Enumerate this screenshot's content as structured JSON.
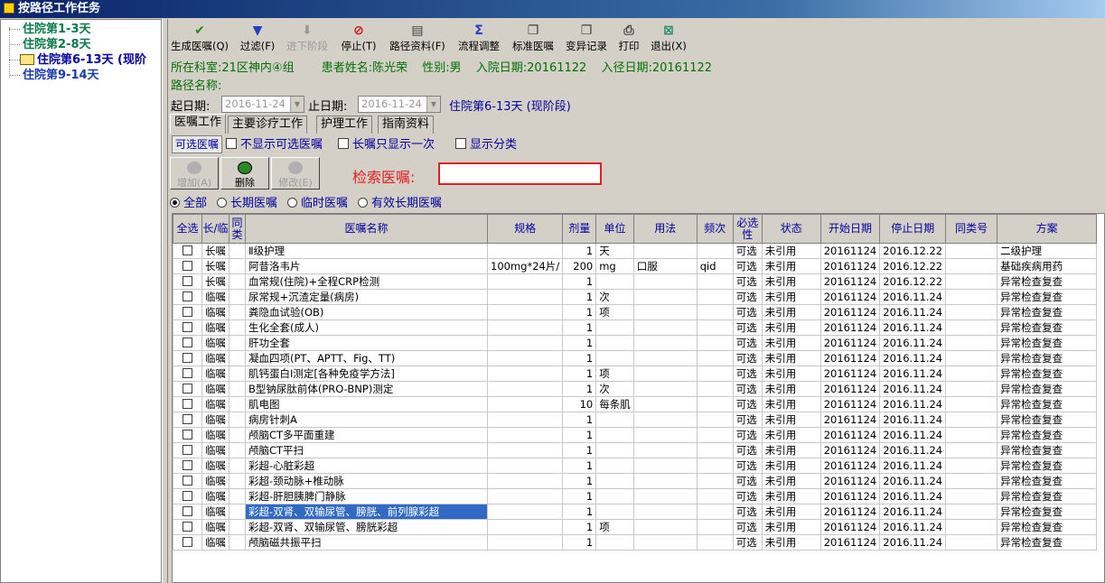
{
  "window": {
    "title": "按路径工作任务"
  },
  "tree": {
    "items": [
      {
        "label": "住院第1-3天"
      },
      {
        "label": "住院第2-8天"
      },
      {
        "label": "住院第6-13天 (现阶"
      },
      {
        "label": "住院第9-14天"
      }
    ]
  },
  "toolbar": {
    "items": [
      {
        "label": "生成医嘱(Q)",
        "icon": "check-icon"
      },
      {
        "label": "过滤(F)",
        "icon": "filter-icon"
      },
      {
        "label": "进下阶段",
        "icon": "arrow-down-icon"
      },
      {
        "label": "停止(T)",
        "icon": "stop-icon"
      },
      {
        "label": "路径资料(F)",
        "icon": "document-icon"
      },
      {
        "label": "流程调整",
        "icon": "sigma-icon"
      },
      {
        "label": "标准医嘱",
        "icon": "copy-icon"
      },
      {
        "label": "变异记录",
        "icon": "copy-icon"
      },
      {
        "label": "打印",
        "icon": "printer-icon"
      },
      {
        "label": "退出(X)",
        "icon": "exit-icon"
      }
    ]
  },
  "patient": {
    "dept": "所在科室:21区神内④组",
    "name": "患者姓名:陈光荣",
    "sex": "性别:男",
    "admit": "入院日期:20161122",
    "enter_path": "入径日期:20161122",
    "path_name": "路径名称:"
  },
  "dates": {
    "start_label": "起日期:",
    "start_value": "2016-11-24",
    "end_label": "止日期:",
    "end_value": "2016-11-24",
    "stage": "住院第6-13天 (现阶段)"
  },
  "tabs": [
    "医嘱工作",
    "主要诊疗工作",
    "护理工作",
    "指南资料"
  ],
  "options": {
    "optional_btn": "可选医嘱",
    "hide_optional": "不显示可选医嘱",
    "long_only_once": "长嘱只显示一次",
    "show_category": "显示分类"
  },
  "buttons": {
    "add": "增加(A)",
    "delete": "删除",
    "modify": "修改(E)"
  },
  "search": {
    "label": "检索医嘱:",
    "value": ""
  },
  "filters": {
    "all": "全部",
    "long": "长期医嘱",
    "temp": "临时医嘱",
    "valid_long": "有效长期医嘱"
  },
  "table": {
    "headers": [
      "全选",
      "长/临",
      "同类",
      "医嘱名称",
      "规格",
      "剂量",
      "单位",
      "用法",
      "频次",
      "必选性",
      "状态",
      "开始日期",
      "停止日期",
      "同类号",
      "方案"
    ],
    "rows": [
      [
        "长嘱",
        "Ⅱ级护理",
        "",
        "1",
        "天",
        "",
        "",
        "可选",
        "未引用",
        "20161124",
        "2016.12.22",
        "",
        "二级护理"
      ],
      [
        "长嘱",
        "阿昔洛韦片",
        "100mg*24片/",
        "200",
        "mg",
        "口服",
        "qid",
        "可选",
        "未引用",
        "20161124",
        "2016.12.22",
        "",
        "基础疾病用药"
      ],
      [
        "长嘱",
        "血常规(住院)+全程CRP检测",
        "",
        "1",
        "",
        "",
        "",
        "可选",
        "未引用",
        "20161124",
        "2016.12.22",
        "",
        "异常检查复查"
      ],
      [
        "临嘱",
        "尿常规+沉渣定量(病房)",
        "",
        "1",
        "次",
        "",
        "",
        "可选",
        "未引用",
        "20161124",
        "2016.11.24",
        "",
        "异常检查复查"
      ],
      [
        "临嘱",
        "粪隐血试验(OB)",
        "",
        "1",
        "项",
        "",
        "",
        "可选",
        "未引用",
        "20161124",
        "2016.11.24",
        "",
        "异常检查复查"
      ],
      [
        "临嘱",
        "生化全套(成人)",
        "",
        "1",
        "",
        "",
        "",
        "可选",
        "未引用",
        "20161124",
        "2016.11.24",
        "",
        "异常检查复查"
      ],
      [
        "临嘱",
        "肝功全套",
        "",
        "1",
        "",
        "",
        "",
        "可选",
        "未引用",
        "20161124",
        "2016.11.24",
        "",
        "异常检查复查"
      ],
      [
        "临嘱",
        "凝血四项(PT、APTT、Fig、TT)",
        "",
        "1",
        "",
        "",
        "",
        "可选",
        "未引用",
        "20161124",
        "2016.11.24",
        "",
        "异常检查复查"
      ],
      [
        "临嘱",
        "肌钙蛋白Ⅰ测定[各种免疫学方法]",
        "",
        "1",
        "项",
        "",
        "",
        "可选",
        "未引用",
        "20161124",
        "2016.11.24",
        "",
        "异常检查复查"
      ],
      [
        "临嘱",
        "B型钠尿肽前体(PRO-BNP)测定",
        "",
        "1",
        "次",
        "",
        "",
        "可选",
        "未引用",
        "20161124",
        "2016.11.24",
        "",
        "异常检查复查"
      ],
      [
        "临嘱",
        "肌电图",
        "",
        "10",
        "每条肌",
        "",
        "",
        "可选",
        "未引用",
        "20161124",
        "2016.11.24",
        "",
        "异常检查复查"
      ],
      [
        "临嘱",
        "病房针刺A",
        "",
        "1",
        "",
        "",
        "",
        "可选",
        "未引用",
        "20161124",
        "2016.11.24",
        "",
        "异常检查复查"
      ],
      [
        "临嘱",
        "颅脑CT多平面重建",
        "",
        "1",
        "",
        "",
        "",
        "可选",
        "未引用",
        "20161124",
        "2016.11.24",
        "",
        "异常检查复查"
      ],
      [
        "临嘱",
        "颅脑CT平扫",
        "",
        "1",
        "",
        "",
        "",
        "可选",
        "未引用",
        "20161124",
        "2016.11.24",
        "",
        "异常检查复查"
      ],
      [
        "临嘱",
        "彩超-心脏彩超",
        "",
        "1",
        "",
        "",
        "",
        "可选",
        "未引用",
        "20161124",
        "2016.11.24",
        "",
        "异常检查复查"
      ],
      [
        "临嘱",
        "彩超-颈动脉+椎动脉",
        "",
        "1",
        "",
        "",
        "",
        "可选",
        "未引用",
        "20161124",
        "2016.11.24",
        "",
        "异常检查复查"
      ],
      [
        "临嘱",
        "彩超-肝胆胰脾门静脉",
        "",
        "1",
        "",
        "",
        "",
        "可选",
        "未引用",
        "20161124",
        "2016.11.24",
        "",
        "异常检查复查"
      ],
      [
        "临嘱",
        "彩超-双肾、双输尿管、膀胱、前列腺彩超",
        "",
        "1",
        "",
        "",
        "",
        "可选",
        "未引用",
        "20161124",
        "2016.11.24",
        "",
        "异常检查复查"
      ],
      [
        "临嘱",
        "彩超-双肾、双输尿管、膀胱彩超",
        "",
        "1",
        "项",
        "",
        "",
        "可选",
        "未引用",
        "20161124",
        "2016.11.24",
        "",
        "异常检查复查"
      ],
      [
        "临嘱",
        "颅脑磁共振平扫",
        "",
        "1",
        "",
        "",
        "",
        "可选",
        "未引用",
        "20161124",
        "2016.11.24",
        "",
        "异常检查复查"
      ]
    ],
    "selected_row": 17
  },
  "colors": {
    "title_bar": "#0a246a",
    "info_green": "#007000",
    "label_blue": "#0000a0",
    "search_red": "#e02020",
    "selection": "#316ac5"
  }
}
